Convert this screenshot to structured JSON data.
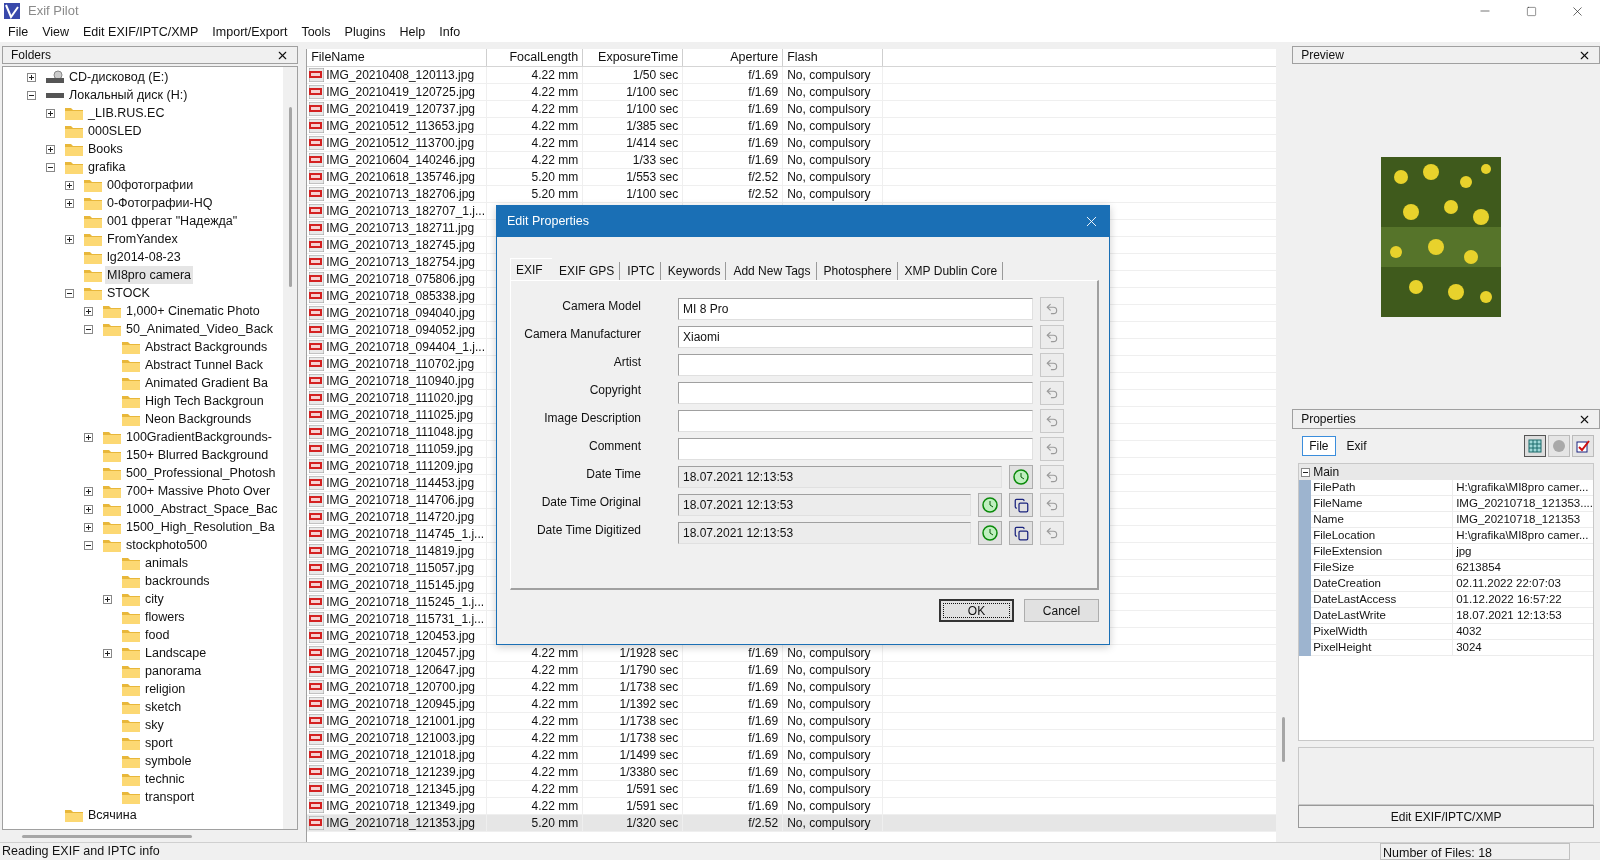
{
  "window": {
    "title": "Exif Pilot"
  },
  "menu": [
    "File",
    "View",
    "Edit EXIF/IPTC/XMP",
    "Import/Export",
    "Tools",
    "Plugins",
    "Help",
    "Info"
  ],
  "tree": {
    "title": "Folders",
    "items": [
      {
        "label": "CD-дисковод (E:)",
        "kind": "cd",
        "expanded": false,
        "selected": false
      },
      {
        "label": "Локальный диск (H:)",
        "kind": "drive",
        "expanded": true,
        "selected": false,
        "children": [
          {
            "label": "_LIB.RUS.EC",
            "kind": "folder",
            "expanded": false,
            "selected": false
          },
          {
            "label": "000SLED",
            "kind": "folder",
            "selected": false
          },
          {
            "label": "Books",
            "kind": "folder",
            "expanded": false,
            "selected": false
          },
          {
            "label": "grafika",
            "kind": "folder",
            "expanded": true,
            "selected": false,
            "children": [
              {
                "label": "00фотографии",
                "kind": "folder",
                "expanded": false,
                "selected": false
              },
              {
                "label": "0-Фотографии-HQ",
                "kind": "folder",
                "expanded": false,
                "selected": false
              },
              {
                "label": "001 фрегат \"Надежда\"",
                "kind": "folder",
                "selected": false
              },
              {
                "label": "FromYandex",
                "kind": "folder",
                "expanded": false,
                "selected": false
              },
              {
                "label": "lg2014-08-23",
                "kind": "folder",
                "selected": false
              },
              {
                "label": "MI8pro camera",
                "kind": "folder",
                "selected": true
              },
              {
                "label": "STOCK",
                "kind": "folder",
                "expanded": true,
                "selected": false,
                "children": [
                  {
                    "label": "1,000+ Cinematic Photo",
                    "kind": "folder",
                    "expanded": false,
                    "selected": false
                  },
                  {
                    "label": "50_Animated_Video_Back",
                    "kind": "folder",
                    "expanded": true,
                    "selected": false,
                    "children": [
                      {
                        "label": "Abstract Backgrounds",
                        "kind": "folder",
                        "selected": false
                      },
                      {
                        "label": "Abstract Tunnel Back",
                        "kind": "folder",
                        "selected": false
                      },
                      {
                        "label": "Animated Gradient Ba",
                        "kind": "folder",
                        "selected": false
                      },
                      {
                        "label": "High Tech Backgroun",
                        "kind": "folder",
                        "selected": false
                      },
                      {
                        "label": "Neon Backgrounds",
                        "kind": "folder",
                        "selected": false
                      }
                    ]
                  },
                  {
                    "label": "100GradientBackgrounds-",
                    "kind": "folder",
                    "expanded": false,
                    "selected": false
                  },
                  {
                    "label": "150+ Blurred Background",
                    "kind": "folder",
                    "selected": false
                  },
                  {
                    "label": "500_Professional_Photosh",
                    "kind": "folder",
                    "selected": false
                  },
                  {
                    "label": "700+ Massive Photo Over",
                    "kind": "folder",
                    "expanded": false,
                    "selected": false
                  },
                  {
                    "label": "1000_Abstract_Space_Bac",
                    "kind": "folder",
                    "expanded": false,
                    "selected": false
                  },
                  {
                    "label": "1500_High_Resolution_Ba",
                    "kind": "folder",
                    "expanded": false,
                    "selected": false
                  },
                  {
                    "label": "stockphoto500",
                    "kind": "folder",
                    "expanded": true,
                    "selected": false,
                    "children": [
                      {
                        "label": "animals",
                        "kind": "folder",
                        "selected": false
                      },
                      {
                        "label": "backrounds",
                        "kind": "folder",
                        "selected": false
                      },
                      {
                        "label": "city",
                        "kind": "folder",
                        "expanded": false,
                        "selected": false
                      },
                      {
                        "label": "flowers",
                        "kind": "folder",
                        "selected": false
                      },
                      {
                        "label": "food",
                        "kind": "folder",
                        "selected": false
                      },
                      {
                        "label": "Landscape",
                        "kind": "folder",
                        "expanded": false,
                        "selected": false
                      },
                      {
                        "label": "panorama",
                        "kind": "folder",
                        "selected": false
                      },
                      {
                        "label": "religion",
                        "kind": "folder",
                        "selected": false
                      },
                      {
                        "label": "sketch",
                        "kind": "folder",
                        "selected": false
                      },
                      {
                        "label": "sky",
                        "kind": "folder",
                        "selected": false
                      },
                      {
                        "label": "sport",
                        "kind": "folder",
                        "selected": false
                      },
                      {
                        "label": "symbole",
                        "kind": "folder",
                        "selected": false
                      },
                      {
                        "label": "technic",
                        "kind": "folder",
                        "selected": false
                      },
                      {
                        "label": "transport",
                        "kind": "folder",
                        "selected": false
                      }
                    ]
                  }
                ]
              }
            ]
          },
          {
            "label": "Всячина",
            "kind": "folder",
            "selected": false
          }
        ]
      }
    ]
  },
  "table": {
    "columns": [
      "FileName",
      "FocalLength",
      "ExposureTime",
      "Aperture",
      "Flash"
    ],
    "rows": [
      {
        "name": "IMG_20210408_120113.jpg",
        "focal": "4.22 mm",
        "exposure": "1/50 sec",
        "aperture": "f/1.69",
        "flash": "No, compulsory",
        "selected": false
      },
      {
        "name": "IMG_20210419_120725.jpg",
        "focal": "4.22 mm",
        "exposure": "1/100 sec",
        "aperture": "f/1.69",
        "flash": "No, compulsory",
        "selected": false
      },
      {
        "name": "IMG_20210419_120737.jpg",
        "focal": "4.22 mm",
        "exposure": "1/100 sec",
        "aperture": "f/1.69",
        "flash": "No, compulsory",
        "selected": false
      },
      {
        "name": "IMG_20210512_113653.jpg",
        "focal": "4.22 mm",
        "exposure": "1/385 sec",
        "aperture": "f/1.69",
        "flash": "No, compulsory",
        "selected": false
      },
      {
        "name": "IMG_20210512_113700.jpg",
        "focal": "4.22 mm",
        "exposure": "1/414 sec",
        "aperture": "f/1.69",
        "flash": "No, compulsory",
        "selected": false
      },
      {
        "name": "IMG_20210604_140246.jpg",
        "focal": "4.22 mm",
        "exposure": "1/33 sec",
        "aperture": "f/1.69",
        "flash": "No, compulsory",
        "selected": false
      },
      {
        "name": "IMG_20210618_135746.jpg",
        "focal": "5.20 mm",
        "exposure": "1/553 sec",
        "aperture": "f/2.52",
        "flash": "No, compulsory",
        "selected": false
      },
      {
        "name": "IMG_20210713_182706.jpg",
        "focal": "5.20 mm",
        "exposure": "1/100 sec",
        "aperture": "f/2.52",
        "flash": "No, compulsory",
        "selected": false
      },
      {
        "name": "IMG_20210713_182707_1.j...",
        "selected": false
      },
      {
        "name": "IMG_20210713_182711.jpg",
        "selected": false
      },
      {
        "name": "IMG_20210713_182745.jpg",
        "selected": false
      },
      {
        "name": "IMG_20210713_182754.jpg",
        "selected": false
      },
      {
        "name": "IMG_20210718_075806.jpg",
        "selected": false
      },
      {
        "name": "IMG_20210718_085338.jpg",
        "selected": false
      },
      {
        "name": "IMG_20210718_094040.jpg",
        "selected": false
      },
      {
        "name": "IMG_20210718_094052.jpg",
        "selected": false
      },
      {
        "name": "IMG_20210718_094404_1.j...",
        "selected": false
      },
      {
        "name": "IMG_20210718_110702.jpg",
        "selected": false
      },
      {
        "name": "IMG_20210718_110940.jpg",
        "selected": false
      },
      {
        "name": "IMG_20210718_111020.jpg",
        "selected": false
      },
      {
        "name": "IMG_20210718_111025.jpg",
        "selected": false
      },
      {
        "name": "IMG_20210718_111048.jpg",
        "selected": false
      },
      {
        "name": "IMG_20210718_111059.jpg",
        "selected": false
      },
      {
        "name": "IMG_20210718_111209.jpg",
        "selected": false
      },
      {
        "name": "IMG_20210718_114453.jpg",
        "selected": false
      },
      {
        "name": "IMG_20210718_114706.jpg",
        "selected": false
      },
      {
        "name": "IMG_20210718_114720.jpg",
        "selected": false
      },
      {
        "name": "IMG_20210718_114745_1.j...",
        "selected": false
      },
      {
        "name": "IMG_20210718_114819.jpg",
        "selected": false
      },
      {
        "name": "IMG_20210718_115057.jpg",
        "selected": false
      },
      {
        "name": "IMG_20210718_115145.jpg",
        "selected": false
      },
      {
        "name": "IMG_20210718_115245_1.j...",
        "selected": false
      },
      {
        "name": "IMG_20210718_115731_1.j...",
        "selected": false
      },
      {
        "name": "IMG_20210718_120453.jpg",
        "selected": false
      },
      {
        "name": "IMG_20210718_120457.jpg",
        "focal": "4.22 mm",
        "exposure": "1/1928 sec",
        "aperture": "f/1.69",
        "flash": "No, compulsory",
        "selected": false
      },
      {
        "name": "IMG_20210718_120647.jpg",
        "focal": "4.22 mm",
        "exposure": "1/1790 sec",
        "aperture": "f/1.69",
        "flash": "No, compulsory",
        "selected": false
      },
      {
        "name": "IMG_20210718_120700.jpg",
        "focal": "4.22 mm",
        "exposure": "1/1738 sec",
        "aperture": "f/1.69",
        "flash": "No, compulsory",
        "selected": false
      },
      {
        "name": "IMG_20210718_120945.jpg",
        "focal": "4.22 mm",
        "exposure": "1/1392 sec",
        "aperture": "f/1.69",
        "flash": "No, compulsory",
        "selected": false
      },
      {
        "name": "IMG_20210718_121001.jpg",
        "focal": "4.22 mm",
        "exposure": "1/1738 sec",
        "aperture": "f/1.69",
        "flash": "No, compulsory",
        "selected": false
      },
      {
        "name": "IMG_20210718_121003.jpg",
        "focal": "4.22 mm",
        "exposure": "1/1738 sec",
        "aperture": "f/1.69",
        "flash": "No, compulsory",
        "selected": false
      },
      {
        "name": "IMG_20210718_121018.jpg",
        "focal": "4.22 mm",
        "exposure": "1/1499 sec",
        "aperture": "f/1.69",
        "flash": "No, compulsory",
        "selected": false
      },
      {
        "name": "IMG_20210718_121239.jpg",
        "focal": "4.22 mm",
        "exposure": "1/3380 sec",
        "aperture": "f/1.69",
        "flash": "No, compulsory",
        "selected": false
      },
      {
        "name": "IMG_20210718_121345.jpg",
        "focal": "4.22 mm",
        "exposure": "1/591 sec",
        "aperture": "f/1.69",
        "flash": "No, compulsory",
        "selected": false
      },
      {
        "name": "IMG_20210718_121349.jpg",
        "focal": "4.22 mm",
        "exposure": "1/591 sec",
        "aperture": "f/1.69",
        "flash": "No, compulsory",
        "selected": false
      },
      {
        "name": "IMG_20210718_121353.jpg",
        "focal": "5.20 mm",
        "exposure": "1/320 sec",
        "aperture": "f/2.52",
        "flash": "No, compulsory",
        "selected": true
      }
    ]
  },
  "preview": {
    "title": "Preview"
  },
  "properties": {
    "title": "Properties",
    "tabs": [
      {
        "label": "File",
        "selected": true
      },
      {
        "label": "Exif",
        "selected": false
      }
    ],
    "group": {
      "label": "Main",
      "expanded": true
    },
    "rows": [
      {
        "name": "FilePath",
        "value": "H:\\grafika\\MI8pro camer..."
      },
      {
        "name": "FileName",
        "value": "IMG_20210718_121353...."
      },
      {
        "name": "Name",
        "value": "IMG_20210718_121353"
      },
      {
        "name": "FileLocation",
        "value": "H:\\grafika\\MI8pro camer..."
      },
      {
        "name": "FileExtension",
        "value": "jpg"
      },
      {
        "name": "FileSize",
        "value": "6213854"
      },
      {
        "name": "DateCreation",
        "value": "02.11.2022 22:07:03"
      },
      {
        "name": "DateLastAccess",
        "value": "01.12.2022 16:57:22"
      },
      {
        "name": "DateLastWrite",
        "value": "18.07.2021 12:13:53"
      },
      {
        "name": "PixelWidth",
        "value": "4032"
      },
      {
        "name": "PixelHeight",
        "value": "3024"
      }
    ],
    "button": "Edit EXIF/IPTC/XMP"
  },
  "dialog": {
    "title": "Edit Properties",
    "tabs": [
      {
        "label": "EXIF",
        "selected": true
      },
      {
        "label": "EXIF GPS",
        "selected": false
      },
      {
        "label": "IPTC",
        "selected": false
      },
      {
        "label": "Keywords",
        "selected": false
      },
      {
        "label": "Add New Tags",
        "selected": false
      },
      {
        "label": "Photosphere",
        "selected": false
      },
      {
        "label": "XMP Dublin Core",
        "selected": false
      }
    ],
    "fields": [
      {
        "label": "Camera Model",
        "value": "MI 8 Pro",
        "kind": "text"
      },
      {
        "label": "Camera Manufacturer",
        "value": "Xiaomi",
        "kind": "text"
      },
      {
        "label": "Artist",
        "kind": "text"
      },
      {
        "label": "Copyright",
        "kind": "text"
      },
      {
        "label": "Image Description",
        "kind": "text"
      },
      {
        "label": "Comment",
        "kind": "text"
      },
      {
        "label": "Date Time",
        "value": "18.07.2021 12:13:53",
        "kind": "datetime"
      },
      {
        "label": "Date Time Original",
        "value": "18.07.2021 12:13:53",
        "kind": "datetime_copy"
      },
      {
        "label": "Date Time Digitized",
        "value": "18.07.2021 12:13:53",
        "kind": "datetime_copy"
      }
    ],
    "buttons": [
      "OK",
      "Cancel"
    ]
  },
  "status_bar": {
    "message": "Reading EXIF and IPTC info",
    "count": "Number of Files: 18"
  }
}
